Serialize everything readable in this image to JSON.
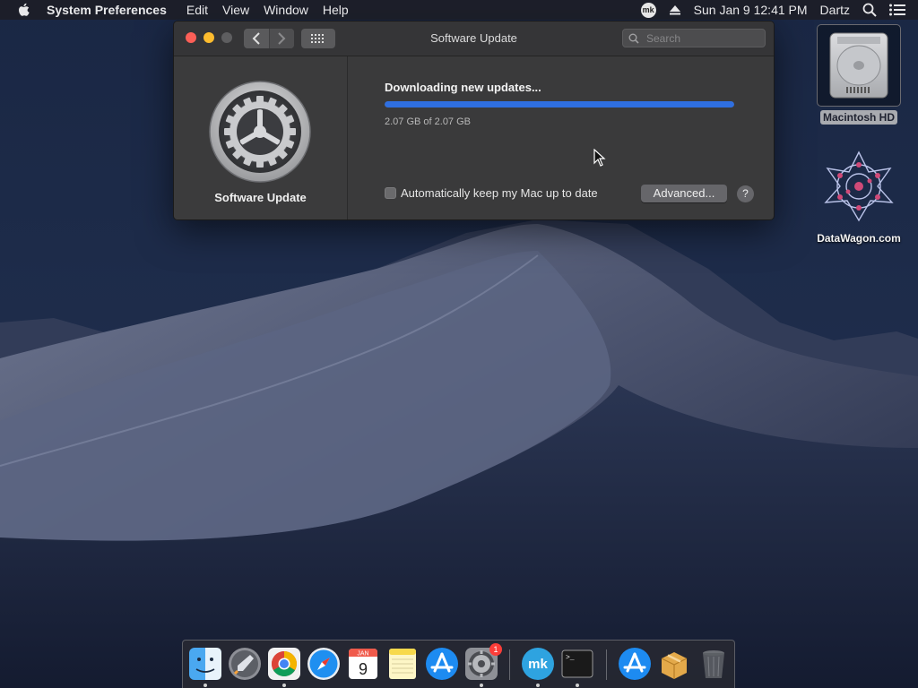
{
  "menubar": {
    "app_name": "System Preferences",
    "menus": [
      "Edit",
      "View",
      "Window",
      "Help"
    ],
    "mk_badge": "mk",
    "datetime": "Sun Jan 9  12:41 PM",
    "user": "Dartz"
  },
  "window": {
    "title": "Software Update",
    "search_placeholder": "Search",
    "pane_label": "Software Update",
    "status_text": "Downloading new updates...",
    "progress_fraction": 1.0,
    "sizes_text": "2.07 GB of 2.07 GB",
    "auto_update_label": "Automatically keep my Mac up to date",
    "auto_update_checked": false,
    "advanced_label": "Advanced...",
    "help_label": "?"
  },
  "desktop": {
    "icons": [
      {
        "label": "Macintosh HD"
      },
      {
        "label": "DataWagon.com"
      }
    ]
  },
  "dock": {
    "items": [
      {
        "name": "Finder"
      },
      {
        "name": "Launchpad"
      },
      {
        "name": "Google Chrome"
      },
      {
        "name": "Safari"
      },
      {
        "name": "Calendar",
        "month": "JAN",
        "day": "9"
      },
      {
        "name": "Notes"
      },
      {
        "name": "App Store"
      },
      {
        "name": "System Preferences",
        "badge": "1"
      },
      {
        "name": "mk"
      },
      {
        "name": "Terminal",
        "prompt": ">_"
      },
      {
        "name": "App Store Downloads"
      },
      {
        "name": "Archive Utility"
      },
      {
        "name": "Trash"
      }
    ]
  },
  "colors": {
    "accent_progress": "#2f6fe0",
    "close": "#fc5f57",
    "minimize": "#fdbc2e"
  }
}
